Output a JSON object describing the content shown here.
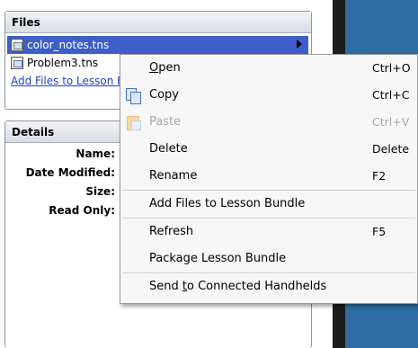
{
  "files_panel": {
    "title": "Files",
    "files": [
      {
        "name": "color_notes.tns",
        "selected": true
      },
      {
        "name": "Problem3.tns",
        "selected": false
      }
    ],
    "add_link": "Add Files to Lesson Bundle"
  },
  "details_panel": {
    "title": "Details",
    "labels": {
      "name": "Name:",
      "date_modified": "Date Modified:",
      "size": "Size:",
      "read_only": "Read Only:"
    }
  },
  "context_menu": {
    "items": [
      {
        "pre": "",
        "ul": "O",
        "post": "pen",
        "shortcut": "Ctrl+O",
        "enabled": true
      },
      {
        "pre": "Copy",
        "ul": "",
        "post": "",
        "shortcut": "Ctrl+C",
        "enabled": true,
        "icon": "copy-icon"
      },
      {
        "pre": "Paste",
        "ul": "",
        "post": "",
        "shortcut": "Ctrl+V",
        "enabled": false,
        "icon": "paste-icon"
      },
      {
        "pre": "Delete",
        "ul": "",
        "post": "",
        "shortcut": "Delete",
        "enabled": true
      },
      {
        "pre": "Rename",
        "ul": "",
        "post": "",
        "shortcut": "F2",
        "enabled": true
      },
      {
        "pre": "Add Files to Lesson Bundle",
        "ul": "",
        "post": "",
        "shortcut": "",
        "enabled": true
      },
      {
        "pre": "Refresh",
        "ul": "",
        "post": "",
        "shortcut": "F5",
        "enabled": true
      },
      {
        "pre": "Package Lesson Bundle",
        "ul": "",
        "post": "",
        "shortcut": "",
        "enabled": true
      },
      {
        "pre": "Send ",
        "ul": "t",
        "post": "o Connected Handhelds",
        "shortcut": "",
        "enabled": true
      }
    ]
  }
}
